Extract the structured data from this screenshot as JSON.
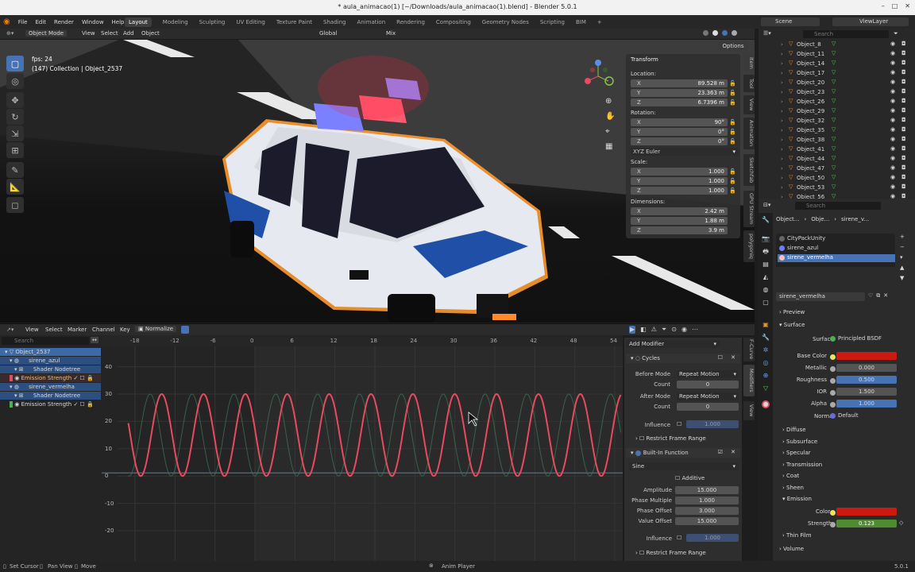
{
  "titlebar": {
    "title": "* aula_animacao(1) [~/Downloads/aula_animacao(1).blend] - Blender 5.0.1",
    "min": "–",
    "max": "□",
    "close": "✕"
  },
  "menu": [
    "File",
    "Edit",
    "Render",
    "Window",
    "Help"
  ],
  "workspaces": [
    "Layout",
    "Modeling",
    "Sculpting",
    "UV Editing",
    "Texture Paint",
    "Shading",
    "Animation",
    "Rendering",
    "Compositing",
    "Geometry Nodes",
    "Scripting",
    "BIM",
    "+"
  ],
  "scene": {
    "label": "Scene",
    "viewlayer": "ViewLayer"
  },
  "viewport": {
    "mode": "Object Mode",
    "menus": [
      "View",
      "Select",
      "Add",
      "Object"
    ],
    "orientation": "Global",
    "mix": "Mix",
    "options": "Options",
    "fps": "fps: 24",
    "info": "(147) Collection | Object_2537"
  },
  "transform": {
    "title": "Transform",
    "location_label": "Location:",
    "location": [
      {
        "k": "X",
        "v": "89.528 m"
      },
      {
        "k": "Y",
        "v": "23.363 m"
      },
      {
        "k": "Z",
        "v": "6.7396 m"
      }
    ],
    "rotation_label": "Rotation:",
    "rotation": [
      {
        "k": "X",
        "v": "90°"
      },
      {
        "k": "Y",
        "v": "0°"
      },
      {
        "k": "Z",
        "v": "0°"
      }
    ],
    "rot_mode": "XYZ Euler",
    "scale_label": "Scale:",
    "scale": [
      {
        "k": "X",
        "v": "1.000"
      },
      {
        "k": "Y",
        "v": "1.000"
      },
      {
        "k": "Z",
        "v": "1.000"
      }
    ],
    "dimensions_label": "Dimensions:",
    "dimensions": [
      {
        "k": "X",
        "v": "2.42 m"
      },
      {
        "k": "Y",
        "v": "1.88 m"
      },
      {
        "k": "Z",
        "v": "3.9 m"
      }
    ]
  },
  "side_tabs": [
    "Item",
    "Tool",
    "View",
    "Animation",
    "Sketchfab",
    "GPU Stream",
    "polygoniq"
  ],
  "graph": {
    "menus": [
      "View",
      "Select",
      "Marker",
      "Channel",
      "Key"
    ],
    "normalize": "Normalize",
    "search_placeholder": "Search",
    "channels": [
      {
        "label": "Object_2537",
        "level": 0,
        "color": "#3c6aa8"
      },
      {
        "label": "sirene_azul",
        "level": 1,
        "color": "#2d4f80"
      },
      {
        "label": "Shader Nodetree",
        "level": 2,
        "color": "#2d4f80"
      },
      {
        "label": "Emission Strength",
        "level": 3,
        "color": "#3a2a2a"
      },
      {
        "label": "sirene_vermelha",
        "level": 1,
        "color": "#2d4f80"
      },
      {
        "label": "Shader Nodetree",
        "level": 2,
        "color": "#2d4f80"
      },
      {
        "label": "Emission Strength",
        "level": 3,
        "color": "#262626"
      }
    ],
    "xticks": [
      "-18",
      "-12",
      "-6",
      "0",
      "6",
      "12",
      "18",
      "24",
      "30",
      "36",
      "42",
      "48",
      "54"
    ],
    "yticks": [
      "40",
      "30",
      "20",
      "10",
      "0",
      "-10",
      "-20"
    ],
    "side_tabs": [
      "F-Curve",
      "Modifiers",
      "View"
    ]
  },
  "modifiers": {
    "add_modifier": "Add Modifier",
    "cycles": {
      "title": "Cycles",
      "before_mode_label": "Before Mode",
      "before_mode": "Repeat Motion",
      "count_label": "Count",
      "count": "0",
      "after_mode_label": "After Mode",
      "after_mode": "Repeat Motion",
      "count2": "0",
      "influence_label": "Influence",
      "influence": "1.000",
      "restrict": "Restrict Frame Range"
    },
    "builtin": {
      "title": "Built-In Function",
      "func": "Sine",
      "additive": "Additive",
      "amplitude_label": "Amplitude",
      "amplitude": "15.000",
      "phase_mult_label": "Phase Multiple",
      "phase_mult": "1.000",
      "phase_off_label": "Phase Offset",
      "phase_off": "3.000",
      "value_off_label": "Value Offset",
      "value_off": "15.000",
      "influence_label": "Influence",
      "influence": "1.000",
      "restrict": "Restrict Frame Range"
    }
  },
  "outliner": {
    "search_placeholder": "Search",
    "items": [
      "Object_8",
      "Object_11",
      "Object_14",
      "Object_17",
      "Object_20",
      "Object_23",
      "Object_26",
      "Object_29",
      "Object_32",
      "Object_35",
      "Object_38",
      "Object_41",
      "Object_44",
      "Object_47",
      "Object_50",
      "Object_53",
      "Object_56"
    ]
  },
  "properties": {
    "search_placeholder": "Search",
    "breadcrumb": [
      "Object...",
      "Obje...",
      "sirene_v..."
    ],
    "materials": [
      "CityPackUnity",
      "sirene_azul",
      "sirene_vermelha"
    ],
    "material_name": "sirene_vermelha",
    "preview": "Preview",
    "surface_section": "Surface",
    "surface_label": "Surface",
    "surface_value": "Principled BSDF",
    "fields": [
      {
        "k": "Base Color",
        "v": "",
        "color": "#cc1a10"
      },
      {
        "k": "Metallic",
        "v": "0.000",
        "color": "#545454"
      },
      {
        "k": "Roughness",
        "v": "0.500",
        "color": "#4772b3"
      },
      {
        "k": "IOR",
        "v": "1.500",
        "color": "#545454"
      },
      {
        "k": "Alpha",
        "v": "1.000",
        "color": "#4772b3"
      }
    ],
    "normal_label": "Normal",
    "normal_value": "Default",
    "sections": [
      "Diffuse",
      "Subsurface",
      "Specular",
      "Transmission",
      "Coat",
      "Sheen",
      "Emission"
    ],
    "emission_color_label": "Color",
    "emission_color": "#cc1a10",
    "strength_label": "Strength",
    "strength": "0.123",
    "more_sections": [
      "Thin Film",
      "Volume"
    ]
  },
  "status": {
    "set_cursor": "Set Cursor",
    "pan_view": "Pan View",
    "move": "Move",
    "anim_player": "Anim Player",
    "version": "5.0.1"
  }
}
